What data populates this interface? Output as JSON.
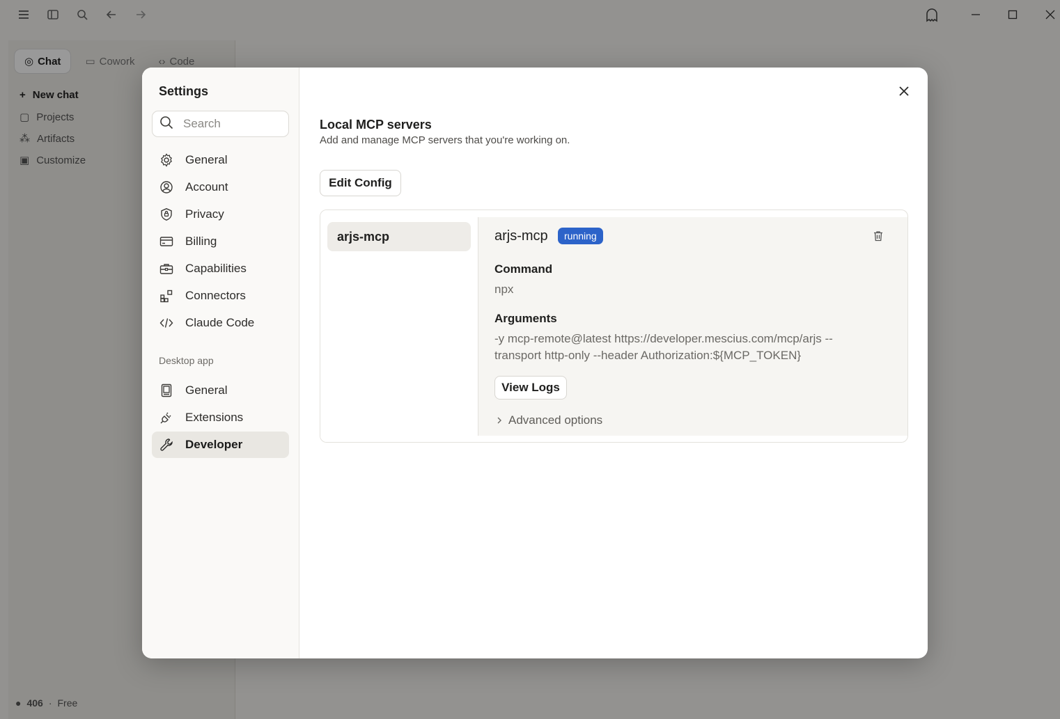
{
  "background": {
    "tabs": [
      {
        "label": "Chat",
        "icon": "chat-icon"
      },
      {
        "label": "Cowork",
        "icon": "cowork-icon"
      },
      {
        "label": "Code",
        "icon": "code-icon"
      }
    ],
    "nav": [
      {
        "label": "New chat",
        "icon": "plus-icon"
      },
      {
        "label": "Projects",
        "icon": "folder-icon"
      },
      {
        "label": "Artifacts",
        "icon": "artifacts-icon"
      },
      {
        "label": "Customize",
        "icon": "customize-icon"
      }
    ],
    "user": {
      "name": "406",
      "plan": "Free"
    }
  },
  "settings": {
    "title": "Settings",
    "search_placeholder": "Search",
    "nav": [
      {
        "label": "General",
        "icon": "gear-icon"
      },
      {
        "label": "Account",
        "icon": "account-icon"
      },
      {
        "label": "Privacy",
        "icon": "shield-icon"
      },
      {
        "label": "Billing",
        "icon": "card-icon"
      },
      {
        "label": "Capabilities",
        "icon": "toolbox-icon"
      },
      {
        "label": "Connectors",
        "icon": "connectors-icon"
      },
      {
        "label": "Claude Code",
        "icon": "code-icon"
      }
    ],
    "desktop_section": "Desktop app",
    "desktop_nav": [
      {
        "label": "General",
        "icon": "device-icon"
      },
      {
        "label": "Extensions",
        "icon": "plug-icon"
      },
      {
        "label": "Developer",
        "icon": "wrench-icon",
        "active": true
      }
    ]
  },
  "main": {
    "title": "Local MCP servers",
    "subtitle": "Add and manage MCP servers that you're working on.",
    "edit_config_label": "Edit Config",
    "servers": [
      {
        "name": "arjs-mcp"
      }
    ],
    "detail": {
      "name": "arjs-mcp",
      "status": "running",
      "command_label": "Command",
      "command": "npx",
      "arguments_label": "Arguments",
      "arguments_line1": "-y mcp-remote@latest https://developer.mescius.com/mcp/arjs --",
      "arguments_line2": "transport http-only --header Authorization:${MCP_TOKEN}",
      "view_logs_label": "View Logs",
      "advanced_label": "Advanced options"
    }
  },
  "colors": {
    "badge": "#2c63c9",
    "active_nav": "#e9e7e2"
  }
}
